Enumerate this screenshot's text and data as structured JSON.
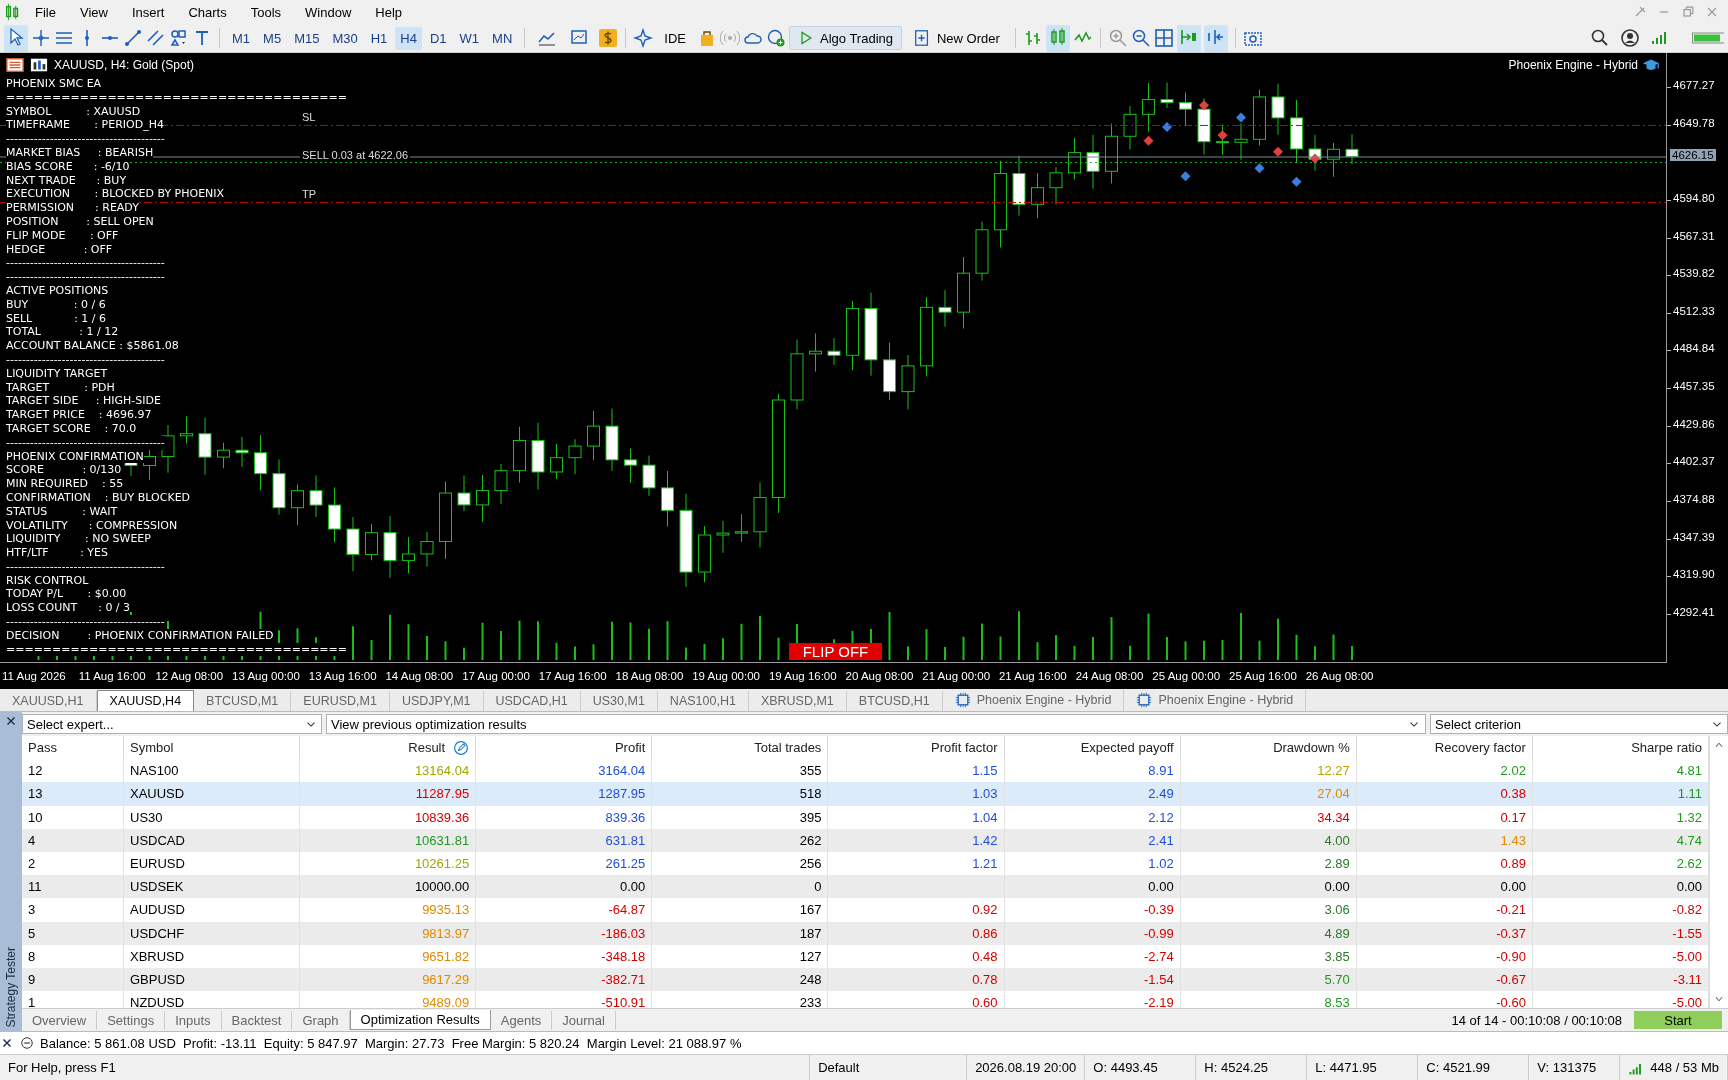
{
  "menu": [
    "File",
    "View",
    "Insert",
    "Charts",
    "Tools",
    "Window",
    "Help"
  ],
  "toolbar": {
    "timeframes": [
      {
        "label": "M1",
        "selected": false
      },
      {
        "label": "M5",
        "selected": false
      },
      {
        "label": "M15",
        "selected": false
      },
      {
        "label": "M30",
        "selected": false
      },
      {
        "label": "H1",
        "selected": false
      },
      {
        "label": "H4",
        "selected": true
      },
      {
        "label": "D1",
        "selected": false
      },
      {
        "label": "W1",
        "selected": false
      },
      {
        "label": "MN",
        "selected": false
      }
    ],
    "ide": "IDE",
    "algo_trading": {
      "label": "Algo Trading",
      "on": true
    },
    "new_order": "New Order"
  },
  "chart": {
    "title": "XAUUSD, H4:  Gold (Spot)",
    "expert": "Phoenix Engine - Hybrid",
    "panel": [
      "PHOENIX SMC EA",
      "=====================================",
      "SYMBOL          : XAUUSD",
      "TIMEFRAME       : PERIOD_H4",
      "----------------------------------------",
      "MARKET BIAS     : BEARISH",
      "BIAS SCORE      : -6/10",
      "NEXT TRADE      : BUY",
      "EXECUTION       : BLOCKED BY PHOENIX",
      "PERMISSION      : READY",
      "POSITION        : SELL OPEN",
      "FLIP MODE       : OFF",
      "HEDGE           : OFF",
      "----------------------------------------",
      "----------------------------------------",
      "ACTIVE POSITIONS",
      "BUY             : 0 / 6",
      "SELL            : 1 / 6",
      "TOTAL           : 1 / 12",
      "ACCOUNT BALANCE : $5861.08",
      "----------------------------------------",
      "LIQUIDITY TARGET",
      "TARGET          : PDH",
      "TARGET SIDE     : HIGH-SIDE",
      "TARGET PRICE    : 4696.97",
      "TARGET SCORE    : 70.0",
      "----------------------------------------",
      "PHOENIX CONFIRMATION",
      "SCORE           : 0/130",
      "MIN REQUIRED    : 55",
      "CONFIRMATION    : BUY BLOCKED",
      "STATUS          : WAIT",
      "VOLATILITY      : COMPRESSION",
      "LIQUIDITY       : NO SWEEP",
      "HTF/LTF         : YES",
      "----------------------------------------",
      "RISK CONTROL",
      "TODAY P/L       : $0.00",
      "LOSS COUNT      : 0 / 3",
      "----------------------------------------",
      "DECISION        : PHOENIX CONFIRMATION FAILED",
      "====================================="
    ],
    "position_label": "SELL 0.03 at 4622.06",
    "sl_label": "SL",
    "tp_label": "TP",
    "flip_label": "FLIP OFF",
    "price_ticks": [
      {
        "text": "4677.27",
        "kind": "tick"
      },
      {
        "text": "4649.78",
        "kind": "tick"
      },
      {
        "text": "4626.15",
        "kind": "current"
      },
      {
        "text": "4594.80",
        "kind": "tick"
      },
      {
        "text": "4567.31",
        "kind": "tick"
      },
      {
        "text": "4539.82",
        "kind": "tick"
      },
      {
        "text": "4512.33",
        "kind": "tick"
      },
      {
        "text": "4484.84",
        "kind": "tick"
      },
      {
        "text": "4457.35",
        "kind": "tick"
      },
      {
        "text": "4429.86",
        "kind": "tick"
      },
      {
        "text": "4402.37",
        "kind": "tick"
      },
      {
        "text": "4374.88",
        "kind": "tick"
      },
      {
        "text": "4347.39",
        "kind": "tick"
      },
      {
        "text": "4319.90",
        "kind": "tick"
      },
      {
        "text": "4292.41",
        "kind": "tick"
      }
    ],
    "time_ticks": [
      "11 Aug 2026",
      "11 Aug 16:00",
      "12 Aug 08:00",
      "13 Aug 00:00",
      "13 Aug 16:00",
      "14 Aug 08:00",
      "17 Aug 00:00",
      "17 Aug 16:00",
      "18 Aug 08:00",
      "19 Aug 00:00",
      "19 Aug 16:00",
      "20 Aug 08:00",
      "21 Aug 00:00",
      "21 Aug 16:00",
      "24 Aug 08:00",
      "25 Aug 00:00",
      "25 Aug 16:00",
      "26 Aug 08:00"
    ]
  },
  "chart_tabs": [
    {
      "label": "XAUUSD,H1",
      "kind": "chart",
      "selected": false
    },
    {
      "label": "XAUUSD,H4",
      "kind": "chart",
      "selected": true
    },
    {
      "label": "BTCUSD,M1",
      "kind": "chart",
      "selected": false
    },
    {
      "label": "EURUSD,M1",
      "kind": "chart",
      "selected": false
    },
    {
      "label": "USDJPY,M1",
      "kind": "chart",
      "selected": false
    },
    {
      "label": "USDCAD,H1",
      "kind": "chart",
      "selected": false
    },
    {
      "label": "US30,M1",
      "kind": "chart",
      "selected": false
    },
    {
      "label": "NAS100,H1",
      "kind": "chart",
      "selected": false
    },
    {
      "label": "XBRUSD,M1",
      "kind": "chart",
      "selected": false
    },
    {
      "label": "BTCUSD,H1",
      "kind": "chart",
      "selected": false
    },
    {
      "label": "Phoenix Engine - Hybrid",
      "kind": "tester",
      "selected": false
    },
    {
      "label": "Phoenix Engine - Hybrid",
      "kind": "tester",
      "selected": false
    }
  ],
  "tester": {
    "title": "Strategy Tester",
    "expert_select": {
      "placeholder": "Select expert..."
    },
    "results_select": "View previous optimization results",
    "criterion_select": {
      "placeholder": "Select criterion"
    },
    "columns": [
      "Pass",
      "Symbol",
      "Result",
      "Profit",
      "Total trades",
      "Profit factor",
      "Expected payoff",
      "Drawdown %",
      "Recovery factor",
      "Sharpe ratio"
    ],
    "rows": [
      {
        "selected": false,
        "cells": [
          {
            "text": "12"
          },
          {
            "text": "NAS100"
          },
          {
            "text": "13164.04",
            "color": "#a0a800"
          },
          {
            "text": "3164.04",
            "color": "#1f4fd8"
          },
          {
            "text": "355",
            "color": "#000000"
          },
          {
            "text": "1.15",
            "color": "#1f4fd8"
          },
          {
            "text": "8.91",
            "color": "#1f4fd8"
          },
          {
            "text": "12.27",
            "color": "#b8a400"
          },
          {
            "text": "2.02",
            "color": "#1e9a1e"
          },
          {
            "text": "4.81",
            "color": "#1e9a1e"
          }
        ]
      },
      {
        "selected": true,
        "cells": [
          {
            "text": "13"
          },
          {
            "text": "XAUUSD"
          },
          {
            "text": "11287.95",
            "color": "#d40000"
          },
          {
            "text": "1287.95",
            "color": "#1f4fd8"
          },
          {
            "text": "518",
            "color": "#000000"
          },
          {
            "text": "1.03",
            "color": "#1f4fd8"
          },
          {
            "text": "2.49",
            "color": "#1f4fd8"
          },
          {
            "text": "27.04",
            "color": "#e08a00"
          },
          {
            "text": "0.38",
            "color": "#d40000"
          },
          {
            "text": "1.11",
            "color": "#1e9a1e"
          }
        ]
      },
      {
        "selected": false,
        "cells": [
          {
            "text": "10"
          },
          {
            "text": "US30"
          },
          {
            "text": "10839.36",
            "color": "#d40000"
          },
          {
            "text": "839.36",
            "color": "#1f4fd8"
          },
          {
            "text": "395",
            "color": "#000000"
          },
          {
            "text": "1.04",
            "color": "#1f4fd8"
          },
          {
            "text": "2.12",
            "color": "#1f4fd8"
          },
          {
            "text": "34.34",
            "color": "#d40000"
          },
          {
            "text": "0.17",
            "color": "#d40000"
          },
          {
            "text": "1.32",
            "color": "#1e9a1e"
          }
        ]
      },
      {
        "selected": false,
        "cells": [
          {
            "text": "4"
          },
          {
            "text": "USDCAD"
          },
          {
            "text": "10631.81",
            "color": "#1e9a1e"
          },
          {
            "text": "631.81",
            "color": "#1f4fd8"
          },
          {
            "text": "262",
            "color": "#000000"
          },
          {
            "text": "1.42",
            "color": "#1f4fd8"
          },
          {
            "text": "2.41",
            "color": "#1f4fd8"
          },
          {
            "text": "4.00",
            "color": "#2a7a2a"
          },
          {
            "text": "1.43",
            "color": "#e08a00"
          },
          {
            "text": "4.74",
            "color": "#1e9a1e"
          }
        ]
      },
      {
        "selected": false,
        "cells": [
          {
            "text": "2"
          },
          {
            "text": "EURUSD"
          },
          {
            "text": "10261.25",
            "color": "#a0a800"
          },
          {
            "text": "261.25",
            "color": "#1f4fd8"
          },
          {
            "text": "256",
            "color": "#000000"
          },
          {
            "text": "1.21",
            "color": "#1f4fd8"
          },
          {
            "text": "1.02",
            "color": "#1f4fd8"
          },
          {
            "text": "2.89",
            "color": "#2a7a2a"
          },
          {
            "text": "0.89",
            "color": "#d40000"
          },
          {
            "text": "2.62",
            "color": "#1e9a1e"
          }
        ]
      },
      {
        "selected": false,
        "cells": [
          {
            "text": "11"
          },
          {
            "text": "USDSEK"
          },
          {
            "text": "10000.00",
            "color": "#000000"
          },
          {
            "text": "0.00",
            "color": "#000000"
          },
          {
            "text": "0",
            "color": "#000000"
          },
          {},
          {
            "text": "0.00",
            "color": "#000000"
          },
          {
            "text": "0.00",
            "color": "#000000"
          },
          {
            "text": "0.00",
            "color": "#000000"
          },
          {
            "text": "0.00",
            "color": "#000000"
          }
        ]
      },
      {
        "selected": false,
        "cells": [
          {
            "text": "3"
          },
          {
            "text": "AUDUSD"
          },
          {
            "text": "9935.13",
            "color": "#e08a00"
          },
          {
            "text": "-64.87",
            "color": "#d40000"
          },
          {
            "text": "167",
            "color": "#000000"
          },
          {
            "text": "0.92",
            "color": "#d40000"
          },
          {
            "text": "-0.39",
            "color": "#d40000"
          },
          {
            "text": "3.06",
            "color": "#2a7a2a"
          },
          {
            "text": "-0.21",
            "color": "#d40000"
          },
          {
            "text": "-0.82",
            "color": "#d40000"
          }
        ]
      },
      {
        "selected": false,
        "cells": [
          {
            "text": "5"
          },
          {
            "text": "USDCHF"
          },
          {
            "text": "9813.97",
            "color": "#e08a00"
          },
          {
            "text": "-186.03",
            "color": "#d40000"
          },
          {
            "text": "187",
            "color": "#000000"
          },
          {
            "text": "0.86",
            "color": "#d40000"
          },
          {
            "text": "-0.99",
            "color": "#d40000"
          },
          {
            "text": "4.89",
            "color": "#2a7a2a"
          },
          {
            "text": "-0.37",
            "color": "#d40000"
          },
          {
            "text": "-1.55",
            "color": "#d40000"
          }
        ]
      },
      {
        "selected": false,
        "cells": [
          {
            "text": "8"
          },
          {
            "text": "XBRUSD"
          },
          {
            "text": "9651.82",
            "color": "#e08a00"
          },
          {
            "text": "-348.18",
            "color": "#d40000"
          },
          {
            "text": "127",
            "color": "#000000"
          },
          {
            "text": "0.48",
            "color": "#d40000"
          },
          {
            "text": "-2.74",
            "color": "#d40000"
          },
          {
            "text": "3.85",
            "color": "#2a7a2a"
          },
          {
            "text": "-0.90",
            "color": "#d40000"
          },
          {
            "text": "-5.00",
            "color": "#d40000"
          }
        ]
      },
      {
        "selected": false,
        "cells": [
          {
            "text": "9"
          },
          {
            "text": "GBPUSD"
          },
          {
            "text": "9617.29",
            "color": "#e08a00"
          },
          {
            "text": "-382.71",
            "color": "#d40000"
          },
          {
            "text": "248",
            "color": "#000000"
          },
          {
            "text": "0.78",
            "color": "#d40000"
          },
          {
            "text": "-1.54",
            "color": "#d40000"
          },
          {
            "text": "5.70",
            "color": "#1e9a1e"
          },
          {
            "text": "-0.67",
            "color": "#d40000"
          },
          {
            "text": "-3.11",
            "color": "#d40000"
          }
        ]
      },
      {
        "selected": false,
        "cells": [
          {
            "text": "1"
          },
          {
            "text": "NZDUSD"
          },
          {
            "text": "9489.09",
            "color": "#e08a00"
          },
          {
            "text": "-510.91",
            "color": "#d40000"
          },
          {
            "text": "233",
            "color": "#000000"
          },
          {
            "text": "0.60",
            "color": "#d40000"
          },
          {
            "text": "-2.19",
            "color": "#d40000"
          },
          {
            "text": "8.53",
            "color": "#1e9a1e"
          },
          {
            "text": "-0.60",
            "color": "#d40000"
          },
          {
            "text": "-5.00",
            "color": "#d40000"
          }
        ]
      }
    ],
    "tabs": [
      {
        "label": "Overview",
        "selected": false
      },
      {
        "label": "Settings",
        "selected": false
      },
      {
        "label": "Inputs",
        "selected": false
      },
      {
        "label": "Backtest",
        "selected": false
      },
      {
        "label": "Graph",
        "selected": false
      },
      {
        "label": "Optimization Results",
        "selected": true
      },
      {
        "label": "Agents",
        "selected": false
      },
      {
        "label": "Journal",
        "selected": false
      }
    ],
    "progress": "14 of 14  -  00:10:08 / 00:10:08",
    "start": "Start"
  },
  "account": "Balance: 5 861.08 USD  Profit: -13.11  Equity: 5 847.97  Margin: 27.73  Free Margin: 5 820.24  Margin Level: 21 088.97 %",
  "status_bar": {
    "help": "For Help, press F1",
    "profile": "Default",
    "time": "2026.08.19 20:00",
    "open": "O: 4493.45",
    "high": "H: 4524.25",
    "low": "L: 4471.95",
    "close": "C: 4521.99",
    "volume": "V: 131375",
    "memory": "448 / 53 Mb"
  }
}
